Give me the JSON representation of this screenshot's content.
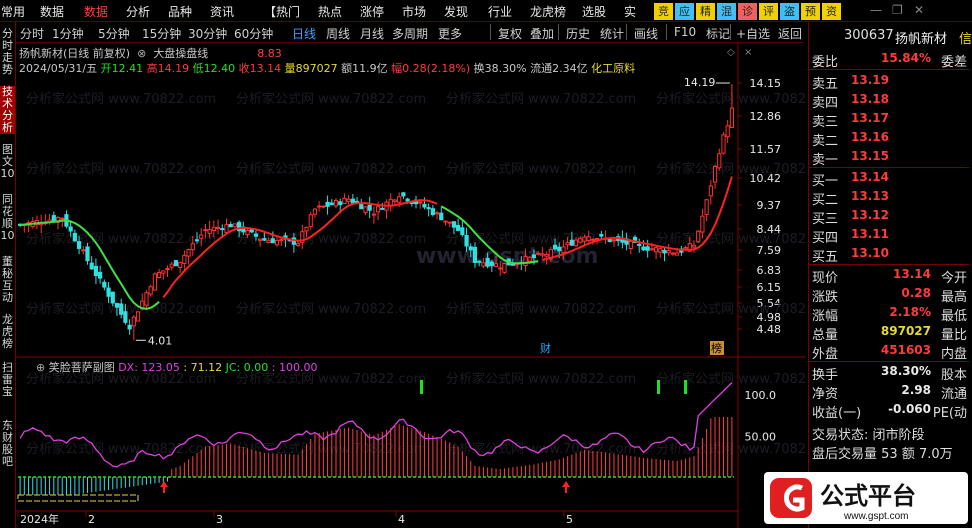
{
  "top_menu": [
    {
      "label": "常用",
      "hot": false
    },
    {
      "label": "数据",
      "hot": false
    },
    {
      "label": "数据",
      "hot": true
    },
    {
      "label": "分析",
      "hot": false
    },
    {
      "label": "品种",
      "hot": false
    },
    {
      "label": "资讯",
      "hot": false
    },
    {
      "label": "【热门",
      "hot": false
    },
    {
      "label": "热点",
      "hot": false
    },
    {
      "label": "涨停",
      "hot": false
    },
    {
      "label": "市场",
      "hot": false
    },
    {
      "label": "发现",
      "hot": false
    },
    {
      "label": "行业",
      "hot": false
    },
    {
      "label": "龙虎榜",
      "hot": false
    },
    {
      "label": "选股",
      "hot": false
    },
    {
      "label": "实",
      "hot": false
    }
  ],
  "quick_buttons": [
    {
      "label": "竞",
      "color": "#f0d000"
    },
    {
      "label": "应",
      "color": "#40c0f0"
    },
    {
      "label": "精",
      "color": "#f0d000"
    },
    {
      "label": "混",
      "color": "#40c0f0"
    },
    {
      "label": "诊",
      "color": "#f06060"
    },
    {
      "label": "评",
      "color": "#f0d000"
    },
    {
      "label": "盗",
      "color": "#40c0f0"
    },
    {
      "label": "预",
      "color": "#f0d000"
    },
    {
      "label": "资",
      "color": "#f0d000"
    }
  ],
  "sidebar": [
    {
      "label": "分时走势",
      "active": false
    },
    {
      "label": "技术分析",
      "active": true
    },
    {
      "label": "图文10",
      "active": false
    },
    {
      "label": "同花顺10",
      "active": false
    },
    {
      "label": "董秘互动",
      "active": false
    },
    {
      "label": "龙虎榜",
      "active": false
    },
    {
      "label": "扫雷宝",
      "active": false
    },
    {
      "label": "东财股吧",
      "active": false
    }
  ],
  "toolbar": {
    "periods": [
      "分时",
      "1分钟",
      "5分钟",
      "15分钟",
      "30分钟",
      "60分钟",
      "日线",
      "周线",
      "月线",
      "多周期",
      "更多"
    ],
    "selected_period": "日线",
    "tools": [
      "复权",
      "叠加",
      "历史",
      "统计",
      "画线",
      "F10",
      "标记",
      "+自选",
      "返回"
    ]
  },
  "chart_title": {
    "stock": "扬帆新材(日线 前复权)",
    "indicator": "大盘操盘线",
    "dim_value": "8.83"
  },
  "info_line": {
    "date": "2024/05/31/五",
    "open_label": "开",
    "open": "12.41",
    "high_label": "高",
    "high": "14.19",
    "low_label": "低",
    "low": "12.40",
    "close_label": "收",
    "close": "13.14",
    "vol_label": "量",
    "vol": "897027",
    "amt": "额11.9亿",
    "chg_label": "幅",
    "chg": "0.28(2.18%)",
    "turnover": "换38.30%",
    "float": "流通2.34亿",
    "sector": "化工原料"
  },
  "price_axis": [
    "14.15",
    "12.86",
    "11.57",
    "10.42",
    "9.37",
    "8.44",
    "7.59",
    "6.83",
    "6.15",
    "5.54",
    "4.98",
    "4.48"
  ],
  "annotations": {
    "high": "14.19",
    "low": "4.01",
    "cai": "财",
    "bang": "榜"
  },
  "indicator": {
    "name": "笑脸菩萨副图",
    "dx_label": "DX: 123.05",
    "v2": ": 71.12",
    "jc": "JC: 0.00",
    "v4": ": 100.00",
    "axis": [
      "100.0",
      "50.00"
    ]
  },
  "x_axis": [
    "2024年",
    "2",
    "3",
    "4",
    "5"
  ],
  "watermarks": [
    "分析家公式网 www.70822.com",
    "www.gspt.com"
  ],
  "right_panel": {
    "code": "300637",
    "name": "扬帆新材",
    "name_suffix": "信",
    "weibi": {
      "label": "委比",
      "value": "15.84%",
      "right": "委差"
    },
    "sell": [
      {
        "label": "卖五",
        "price": "13.19"
      },
      {
        "label": "卖四",
        "price": "13.18"
      },
      {
        "label": "卖三",
        "price": "13.17"
      },
      {
        "label": "卖二",
        "price": "13.16"
      },
      {
        "label": "卖一",
        "price": "13.15"
      }
    ],
    "buy": [
      {
        "label": "买一",
        "price": "13.14"
      },
      {
        "label": "买二",
        "price": "13.13"
      },
      {
        "label": "买三",
        "price": "13.12"
      },
      {
        "label": "买四",
        "price": "13.11"
      },
      {
        "label": "买五",
        "price": "13.10"
      }
    ],
    "stats": [
      {
        "label": "现价",
        "value": "13.14",
        "color": "red",
        "right": "今开"
      },
      {
        "label": "涨跌",
        "value": "0.28",
        "color": "red",
        "right": "最高"
      },
      {
        "label": "涨幅",
        "value": "2.18%",
        "color": "red",
        "right": "最低"
      },
      {
        "label": "总量",
        "value": "897027",
        "color": "yel",
        "right": "量比"
      },
      {
        "label": "外盘",
        "value": "451603",
        "color": "red",
        "right": "内盘"
      }
    ],
    "stats2": [
      {
        "label": "换手",
        "value": "38.30%",
        "color": "wht",
        "right": "股本"
      },
      {
        "label": "净资",
        "value": "2.98",
        "color": "wht",
        "right": "流通"
      },
      {
        "label": "收益(一)",
        "value": "-0.060",
        "color": "wht",
        "right": "PE(动"
      }
    ],
    "trade_status": "交易状态: 闭市阶段",
    "after_hours": "盘后交易量  53 额 7.0万"
  },
  "logo": {
    "text": "公式平台",
    "url": "www.gspt.com"
  }
}
